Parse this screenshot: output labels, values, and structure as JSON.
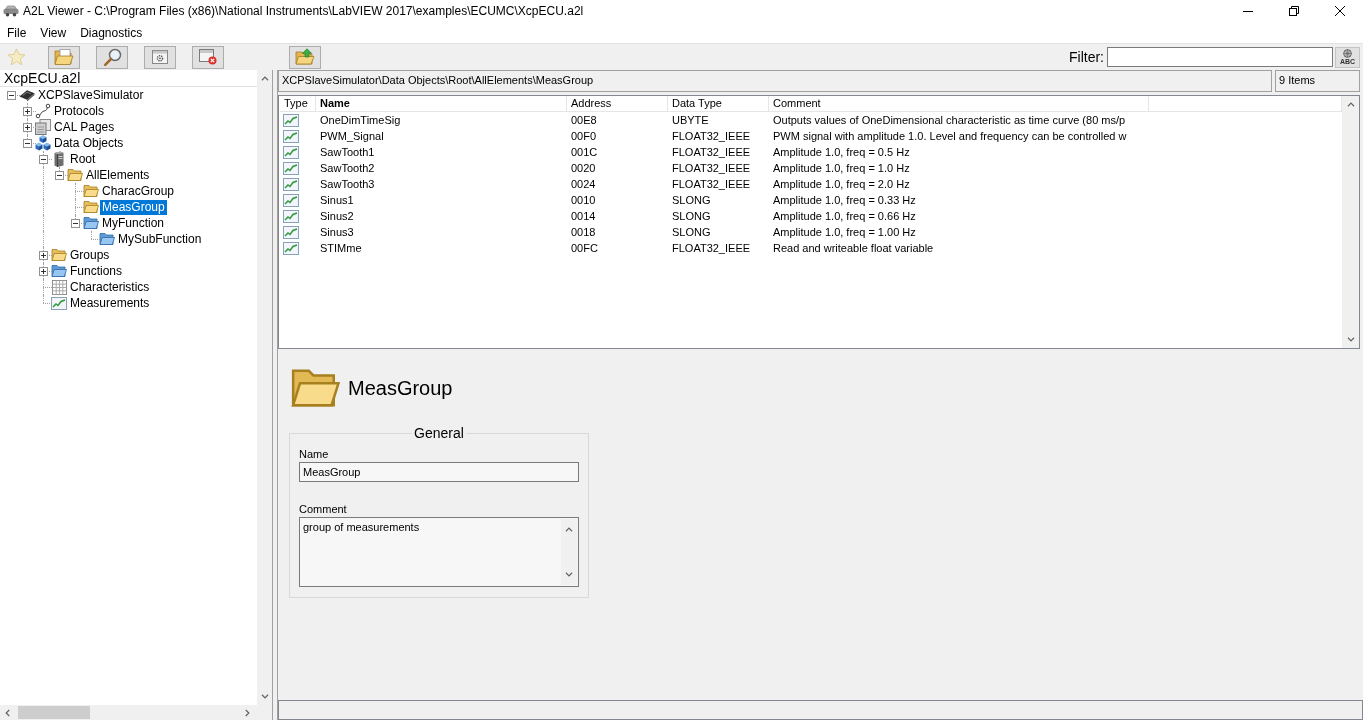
{
  "window": {
    "title": "A2L Viewer - C:\\Program Files (x86)\\National Instruments\\LabVIEW 2017\\examples\\ECUMC\\XcpECU.a2l"
  },
  "menu": [
    "File",
    "View",
    "Diagnostics"
  ],
  "toolbar_groups": [
    [
      {
        "kind": "favorite",
        "disabled": true
      },
      {
        "kind": "open",
        "disabled": false
      },
      {
        "kind": "search",
        "disabled": false
      },
      {
        "kind": "settings",
        "disabled": false
      },
      {
        "kind": "close",
        "disabled": false
      }
    ],
    [
      {
        "kind": "parent",
        "disabled": false
      }
    ]
  ],
  "filter": {
    "label": "Filter:",
    "button": "ABC"
  },
  "tree": {
    "title": "XcpECU.a2l",
    "items": [
      {
        "label": "XCPSlaveSimulator",
        "kind": "device",
        "expanded": true,
        "selected": false,
        "children": [
          {
            "label": "Protocols",
            "kind": "protocol",
            "expanded": false,
            "selected": false
          },
          {
            "label": "CAL Pages",
            "kind": "pages",
            "expanded": false,
            "selected": false
          },
          {
            "label": "Data Objects",
            "kind": "objects",
            "expanded": true,
            "selected": false,
            "children": [
              {
                "label": "Root",
                "kind": "root",
                "expanded": true,
                "selected": false,
                "children": [
                  {
                    "label": "AllElements",
                    "kind": "group",
                    "expanded": true,
                    "selected": false,
                    "children": [
                      {
                        "label": "CharacGroup",
                        "kind": "group",
                        "selected": false
                      },
                      {
                        "label": "MeasGroup",
                        "kind": "group",
                        "selected": true
                      },
                      {
                        "label": "MyFunction",
                        "kind": "function",
                        "expanded": true,
                        "selected": false,
                        "children": [
                          {
                            "label": "MySubFunction",
                            "kind": "function",
                            "selected": false
                          }
                        ]
                      }
                    ]
                  }
                ]
              },
              {
                "label": "Groups",
                "kind": "group",
                "expanded": false,
                "selected": false
              },
              {
                "label": "Functions",
                "kind": "function",
                "expanded": false,
                "selected": false
              },
              {
                "label": "Characteristics",
                "kind": "table",
                "selected": false
              },
              {
                "label": "Measurements",
                "kind": "chart",
                "selected": false
              }
            ]
          }
        ]
      }
    ]
  },
  "path_bar": {
    "path": "XCPSlaveSimulator\\Data Objects\\Root\\AllElements\\MeasGroup",
    "count": "9 Items"
  },
  "table": {
    "columns": [
      {
        "label": "Type",
        "sorted": false
      },
      {
        "label": "Name",
        "sorted": true
      },
      {
        "label": "Address",
        "sorted": false
      },
      {
        "label": "Data Type",
        "sorted": false
      },
      {
        "label": "Comment",
        "sorted": false
      }
    ],
    "rows": [
      {
        "name": "OneDimTimeSig",
        "address": "00E8",
        "data_type": "UBYTE",
        "comment": "Outputs values of OneDimensional characteristic as time curve (80 ms/p"
      },
      {
        "name": "PWM_Signal",
        "address": "00F0",
        "data_type": "FLOAT32_IEEE",
        "comment": "PWM signal with amplitude 1.0. Level and frequency can be controlled w"
      },
      {
        "name": "SawTooth1",
        "address": "001C",
        "data_type": "FLOAT32_IEEE",
        "comment": "Amplitude 1.0, freq = 0.5 Hz"
      },
      {
        "name": "SawTooth2",
        "address": "0020",
        "data_type": "FLOAT32_IEEE",
        "comment": "Amplitude 1.0, freq = 1.0 Hz"
      },
      {
        "name": "SawTooth3",
        "address": "0024",
        "data_type": "FLOAT32_IEEE",
        "comment": "Amplitude 1.0, freq = 2.0 Hz"
      },
      {
        "name": "Sinus1",
        "address": "0010",
        "data_type": "SLONG",
        "comment": "Amplitude 1.0, freq = 0.33 Hz"
      },
      {
        "name": "Sinus2",
        "address": "0014",
        "data_type": "SLONG",
        "comment": "Amplitude 1.0, freq = 0.66 Hz"
      },
      {
        "name": "Sinus3",
        "address": "0018",
        "data_type": "SLONG",
        "comment": "Amplitude 1.0, freq = 1.00 Hz"
      },
      {
        "name": "STIMme",
        "address": "00FC",
        "data_type": "FLOAT32_IEEE",
        "comment": "Read and writeable float variable"
      }
    ]
  },
  "detail": {
    "kind": "group",
    "title": "MeasGroup",
    "group": "General",
    "fields": [
      {
        "kind": "line",
        "label": "Name",
        "value": "MeasGroup"
      },
      {
        "kind": "area",
        "label": "Comment",
        "value": "group of measurements"
      }
    ]
  }
}
